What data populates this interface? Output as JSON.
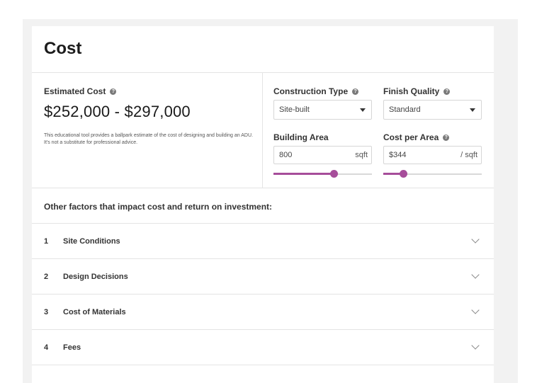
{
  "header": {
    "title": "Cost"
  },
  "estimate": {
    "label": "Estimated Cost",
    "value": "$252,000 - $297,000",
    "note": "This educational tool provides a ballpark estimate of the cost of designing and building an ADU. It's not a substitute for professional advice."
  },
  "construction_type": {
    "label": "Construction Type",
    "selected": "Site-built"
  },
  "finish_quality": {
    "label": "Finish Quality",
    "selected": "Standard"
  },
  "building_area": {
    "label": "Building Area",
    "value": "800",
    "unit": "sqft",
    "slider_fraction": 0.61
  },
  "cost_per_area": {
    "label": "Cost per Area",
    "prefix": "$",
    "value": "344",
    "unit": "/ sqft",
    "slider_fraction": 0.2
  },
  "help_glyph": "?",
  "factors": {
    "heading": "Other factors that impact cost and return on investment:",
    "items": [
      {
        "num": "1",
        "label": "Site Conditions"
      },
      {
        "num": "2",
        "label": "Design Decisions"
      },
      {
        "num": "3",
        "label": "Cost of Materials"
      },
      {
        "num": "4",
        "label": "Fees"
      }
    ]
  },
  "colors": {
    "accent": "#a64d9a",
    "border": "#e4e4e4",
    "backdrop": "#f2f2f2"
  }
}
